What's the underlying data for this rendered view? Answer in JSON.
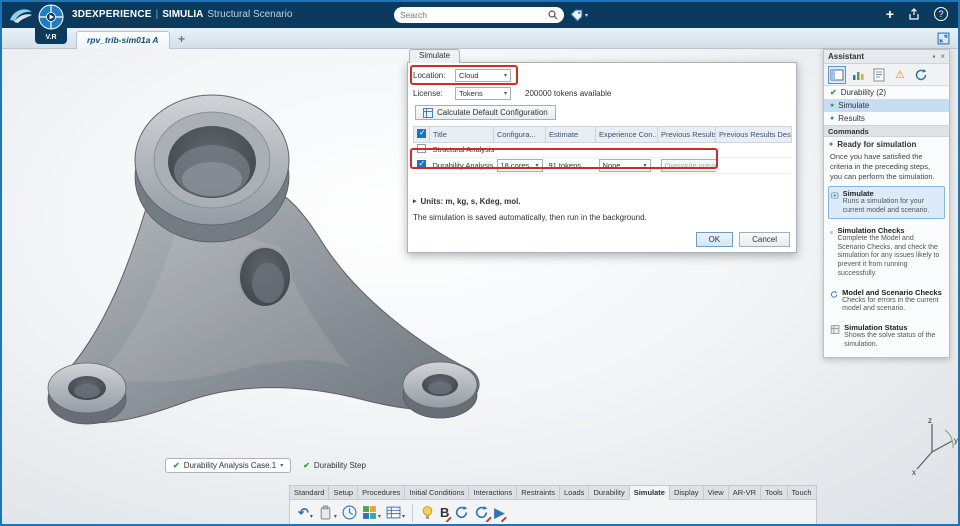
{
  "titlebar": {
    "brand": "3DEXPERIENCE",
    "divider": "|",
    "app_name": "SIMULIA",
    "app_context": "Structural Scenario",
    "search_placeholder": "Search",
    "compass_label": "V.R"
  },
  "tabbar": {
    "active_tab": "rpv_trib-sim01a A"
  },
  "icons": {
    "plus": "+",
    "help": "?",
    "close": "×",
    "caret": "▾",
    "check": "✔",
    "dot": "●",
    "expander": "▸",
    "warning": "⚠",
    "undo": "↶",
    "play": "▶",
    "bold_b": "B",
    "pin": "▪"
  },
  "dialog": {
    "tab_label": "Simulate",
    "location_label": "Location:",
    "location_value": "Cloud",
    "license_label": "License:",
    "license_value": "Tokens",
    "license_available": "200000 tokens available",
    "calculate_button": "Calculate Default Configuration",
    "columns": {
      "title": "Title",
      "configuration": "Configura...",
      "estimate": "Estimate",
      "experience": "Experience Con...",
      "previous_results": "Previous Results",
      "previous_results_description": "Previous Results Description"
    },
    "rows": [
      {
        "title": "Structural Analysis ..."
      },
      {
        "title": "Durability Analysis ...",
        "configuration": "18 cores",
        "estimate": "91 tokens",
        "experience": "None",
        "previous_results": "Overwrite previous"
      }
    ],
    "units_label": "Units: m, kg, s, Kdeg, mol.",
    "note": "The simulation is saved automatically, then run in the background.",
    "ok_button": "OK",
    "cancel_button": "Cancel"
  },
  "assistant": {
    "title": "Assistant",
    "steps": [
      {
        "label": "Durability (2)"
      },
      {
        "label": "Simulate"
      },
      {
        "label": "Results"
      }
    ],
    "commands_header": "Commands",
    "status_label": "Ready for simulation",
    "status_text": "Once you have satisfied the criteria in the preceding steps, you can perform the simulation.",
    "commands": [
      {
        "name": "Simulate",
        "description": "Runs a simulation for your current model and scenario."
      },
      {
        "name": "Simulation Checks",
        "description": "Complete the Model and Scenario Checks, and check the simulation for any issues likely to prevent it from running successfully."
      },
      {
        "name": "Model and Scenario Checks",
        "description": "Checks for errors in the current model and scenario."
      },
      {
        "name": "Simulation Status",
        "description": "Shows the solve status of the simulation."
      }
    ]
  },
  "viewport": {
    "case_selector": "Durability Analysis Case.1",
    "step_indicator": "Durability Step",
    "triad": {
      "x": "x",
      "y": "y",
      "z": "z"
    }
  },
  "ribbon": {
    "tabs": [
      "Standard",
      "Setup",
      "Procedures",
      "Initial Conditions",
      "Interactions",
      "Restraints",
      "Loads",
      "Durability",
      "Simulate",
      "Display",
      "View",
      "AR-VR",
      "Tools",
      "Touch"
    ]
  }
}
